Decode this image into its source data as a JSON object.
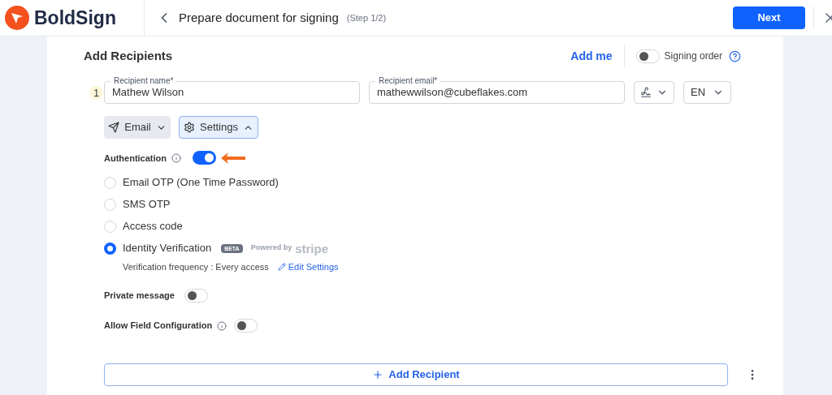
{
  "header": {
    "logo": "BoldSign",
    "title": "Prepare document for signing",
    "step": "(Step 1/2)",
    "next_button": "Next"
  },
  "section": {
    "title": "Add Recipients",
    "add_me": "Add me",
    "signing_order": {
      "label": "Signing order",
      "on": false
    }
  },
  "recipient": {
    "number": "1",
    "name": {
      "label": "Recipient name*",
      "value": "Mathew Wilson"
    },
    "email": {
      "label": "Recipient email*",
      "value": "mathewwilson@cubeflakes.com"
    },
    "language": "EN",
    "delivery": "Email",
    "settings": {
      "label": "Settings",
      "expanded": true
    }
  },
  "authentication": {
    "label": "Authentication",
    "on": true,
    "options": [
      {
        "label": "Email OTP (One Time Password)",
        "selected": false
      },
      {
        "label": "SMS OTP",
        "selected": false
      },
      {
        "label": "Access code",
        "selected": false
      },
      {
        "label": "Identity Verification",
        "selected": true,
        "badge": "BETA",
        "powered_by": "Powered by",
        "provider": "stripe",
        "frequency": "Verification frequency : Every access",
        "edit": "Edit Settings"
      }
    ]
  },
  "private_message": {
    "label": "Private message",
    "on": false
  },
  "allow_field_configuration": {
    "label": "Allow Field Configuration",
    "on": false
  },
  "add_recipient": "Add Recipient"
}
